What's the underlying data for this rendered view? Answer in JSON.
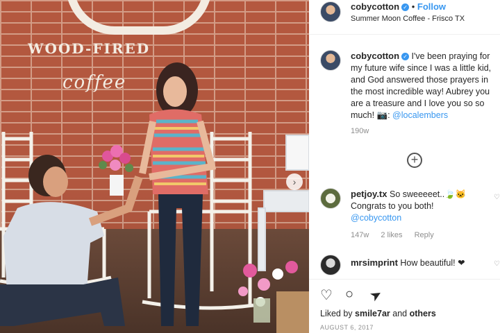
{
  "photo": {
    "sign_wood": "WOOD-FIRED",
    "sign_coffee": "coffee",
    "next_arrow": "›"
  },
  "header": {
    "username": "cobycotton",
    "follow_label": "Follow",
    "location": "Summer Moon Coffee - Frisco TX",
    "verified_icon": "✓"
  },
  "caption": {
    "username": "cobycotton",
    "text": "I've been praying for my future wife since I was a little kid, and God answered those prayers in the most incredible way! Aubrey you are a treasure and I love you so so much! 📷:",
    "mention": "@localembers",
    "time": "190w"
  },
  "load_more_icon": "+",
  "comments": [
    {
      "username": "petjoy.tx",
      "text": "So sweeeeet..🍃🐱 Congrats to you both!",
      "mention": "@cobycotton",
      "time": "147w",
      "likes": "2 likes",
      "reply": "Reply"
    },
    {
      "username": "mrsimprint",
      "text": "How beautiful! ❤"
    }
  ],
  "actions": {
    "like_icon": "♡",
    "comment_icon": "○",
    "share_icon": "➤"
  },
  "likes": {
    "prefix": "Liked by",
    "user": "smile7ar",
    "middle": "and",
    "others": "others"
  },
  "date": "AUGUST 6, 2017"
}
